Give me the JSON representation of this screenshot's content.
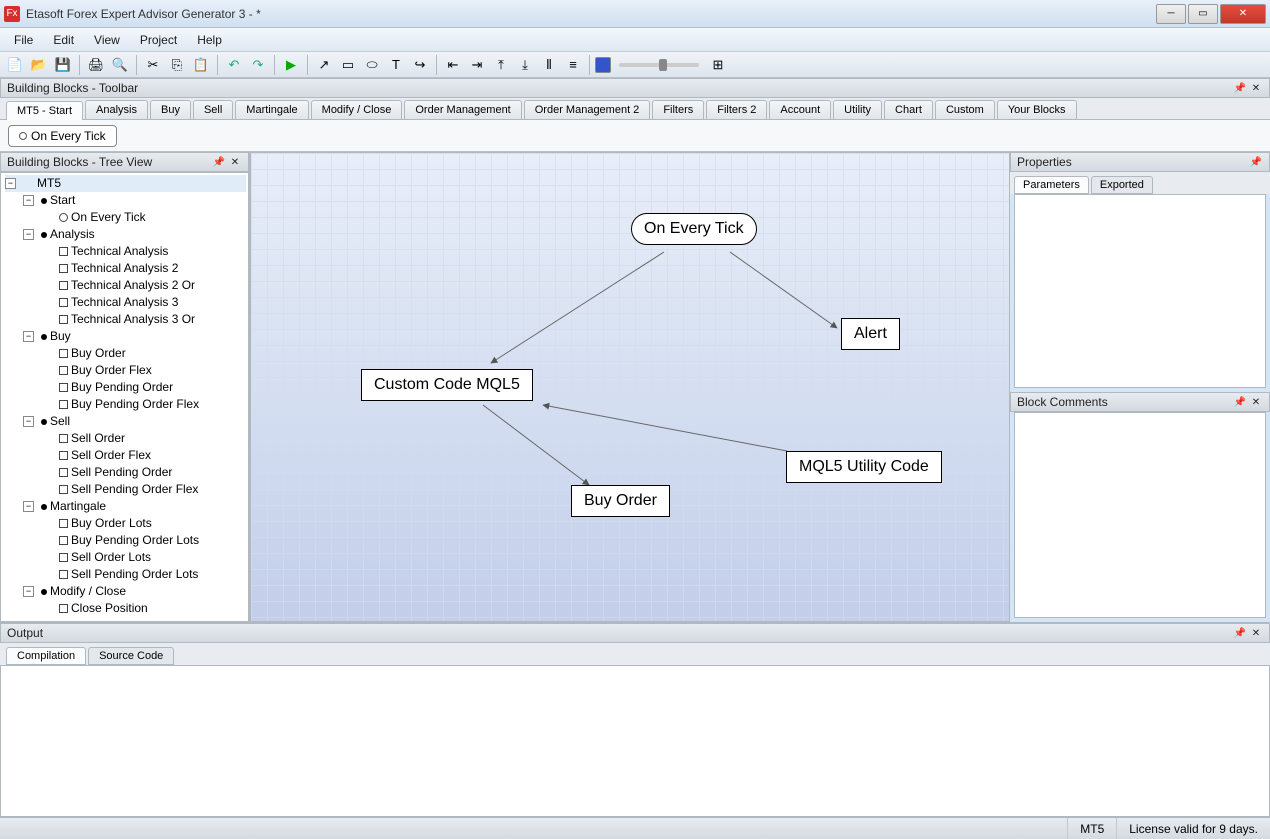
{
  "window": {
    "title": "Etasoft Forex Expert Advisor Generator 3 - *",
    "icon_text": "Fx"
  },
  "menu": [
    "File",
    "Edit",
    "View",
    "Project",
    "Help"
  ],
  "panels": {
    "building_blocks_toolbar": "Building Blocks - Toolbar",
    "building_blocks_tree": "Building Blocks - Tree View",
    "properties": "Properties",
    "block_comments": "Block Comments",
    "output": "Output"
  },
  "bb_tabs": [
    "MT5 - Start",
    "Analysis",
    "Buy",
    "Sell",
    "Martingale",
    "Modify / Close",
    "Order Management",
    "Order Management 2",
    "Filters",
    "Filters 2",
    "Account",
    "Utility",
    "Chart",
    "Custom",
    "Your Blocks"
  ],
  "bb_toolbar_item": "On Every Tick",
  "tree": {
    "root": "MT5",
    "groups": [
      {
        "label": "Start",
        "items": [
          "On Every Tick"
        ]
      },
      {
        "label": "Analysis",
        "items": [
          "Technical Analysis",
          "Technical Analysis 2",
          "Technical Analysis 2 Or",
          "Technical Analysis 3",
          "Technical Analysis 3 Or"
        ]
      },
      {
        "label": "Buy",
        "items": [
          "Buy Order",
          "Buy Order Flex",
          "Buy Pending Order",
          "Buy Pending Order Flex"
        ]
      },
      {
        "label": "Sell",
        "items": [
          "Sell Order",
          "Sell Order Flex",
          "Sell Pending Order",
          "Sell Pending Order Flex"
        ]
      },
      {
        "label": "Martingale",
        "items": [
          "Buy Order Lots",
          "Buy Pending Order Lots",
          "Sell Order Lots",
          "Sell Pending Order Lots"
        ]
      },
      {
        "label": "Modify / Close",
        "items": [
          "Close Position"
        ]
      }
    ]
  },
  "nodes": {
    "on_every_tick": "On Every Tick",
    "alert": "Alert",
    "custom_code": "Custom Code MQL5",
    "buy_order": "Buy Order",
    "utility_code": "MQL5 Utility Code"
  },
  "prop_tabs": [
    "Parameters",
    "Exported"
  ],
  "output_tabs": [
    "Compilation",
    "Source Code"
  ],
  "status": {
    "target": "MT5",
    "license": "License valid for 9 days."
  }
}
